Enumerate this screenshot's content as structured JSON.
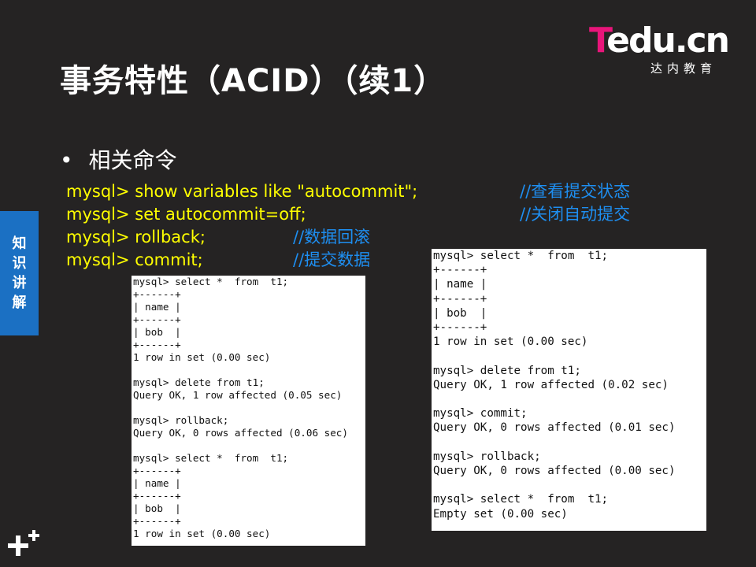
{
  "title": "事务特性（ACID）（续1）",
  "logo": {
    "mark_t": "T",
    "mark_rest": "edu.cn",
    "sub": "达内教育",
    "accent": "#e8157a"
  },
  "side_tab": [
    "知",
    "识",
    "讲",
    "解"
  ],
  "bullet": "相关命令",
  "commands": [
    {
      "code": "mysql>  show variables  like \"autocommit\";",
      "comment": "//查看提交状态"
    },
    {
      "code": "mysql>  set autocommit=off;",
      "comment": "//关闭自动提交"
    },
    {
      "code": "mysql>  rollback;",
      "comment": "//数据回滚"
    },
    {
      "code": "mysql>  commit;",
      "comment": "//提交数据"
    }
  ],
  "terminal_left": [
    "mysql> select *  from  t1;",
    "+------+",
    "| name |",
    "+------+",
    "| bob  |",
    "+------+",
    "1 row in set (0.00 sec)",
    "",
    "mysql> delete from t1;",
    "Query OK, 1 row affected (0.05 sec)",
    "",
    "mysql> rollback;",
    "Query OK, 0 rows affected (0.06 sec)",
    "",
    "mysql> select *  from  t1;",
    "+------+",
    "| name |",
    "+------+",
    "| bob  |",
    "+------+",
    "1 row in set (0.00 sec)"
  ],
  "terminal_right": [
    "mysql> select *  from  t1;",
    "+------+",
    "| name |",
    "+------+",
    "| bob  |",
    "+------+",
    "1 row in set (0.00 sec)",
    "",
    "mysql> delete from t1;",
    "Query OK, 1 row affected (0.02 sec)",
    "",
    "mysql> commit;",
    "Query OK, 0 rows affected (0.01 sec)",
    "",
    "mysql> rollback;",
    "Query OK, 0 rows affected (0.00 sec)",
    "",
    "mysql> select *  from  t1;",
    "Empty set (0.00 sec)"
  ],
  "icons": {
    "corner": "plus-plus-icon"
  }
}
